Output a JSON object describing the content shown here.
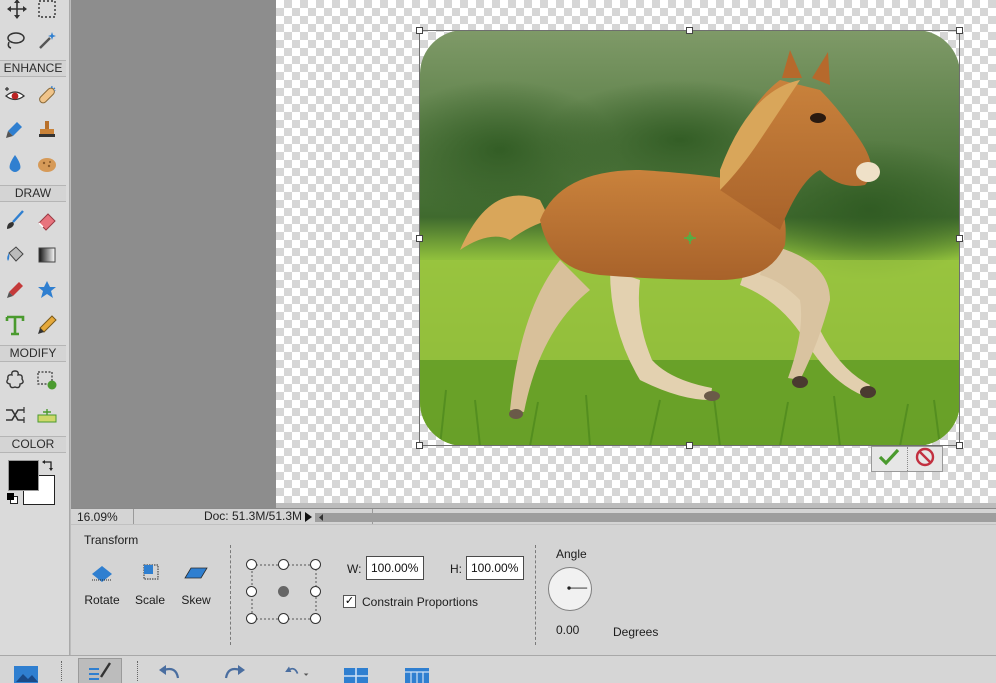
{
  "toolbox": {
    "sections": {
      "enhance": "ENHANCE",
      "draw": "DRAW",
      "modify": "MODIFY",
      "color": "COLOR"
    },
    "tools": {
      "select": [
        "move-tool-icon",
        "marquee-tool-icon",
        "lasso-tool-icon",
        "magic-wand-icon"
      ],
      "enhance": [
        "red-eye-icon",
        "spot-healing-icon",
        "smart-brush-icon",
        "clone-stamp-icon",
        "blur-icon",
        "sponge-icon"
      ],
      "draw": [
        "brush-icon",
        "eraser-icon",
        "paint-bucket-icon",
        "gradient-icon",
        "eyedropper-icon",
        "custom-shape-icon",
        "type-tool-icon",
        "pencil-icon"
      ],
      "modify": [
        "cookie-cutter-icon",
        "recompose-icon",
        "content-aware-move-icon",
        "straighten-icon"
      ]
    },
    "colors": {
      "foreground": "#000000",
      "background": "#ffffff"
    }
  },
  "status": {
    "zoom": "16.09%",
    "doc": "Doc: 51.3M/51.3M"
  },
  "options": {
    "section_title": "Transform",
    "buttons": {
      "rotate": "Rotate",
      "scale": "Scale",
      "skew": "Skew"
    },
    "width_label": "W:",
    "width_value": "100.00%",
    "height_label": "H:",
    "height_value": "100.00%",
    "constrain_label": "Constrain Proportions",
    "constrain_checked": true,
    "angle_label": "Angle",
    "angle_value": "0.00",
    "angle_unit": "Degrees"
  },
  "commit": {
    "confirm": "check-icon",
    "cancel": "cancel-icon"
  },
  "taskbar": [
    "photo-bin-icon",
    "tool-options-icon",
    "undo-icon",
    "redo-icon",
    "rotate-icon",
    "layout-icon",
    "organizer-icon"
  ],
  "colors": {
    "accent_green": "#4a9a2e",
    "cancel_red": "#c23040",
    "tool_blue": "#2f7fd0"
  }
}
